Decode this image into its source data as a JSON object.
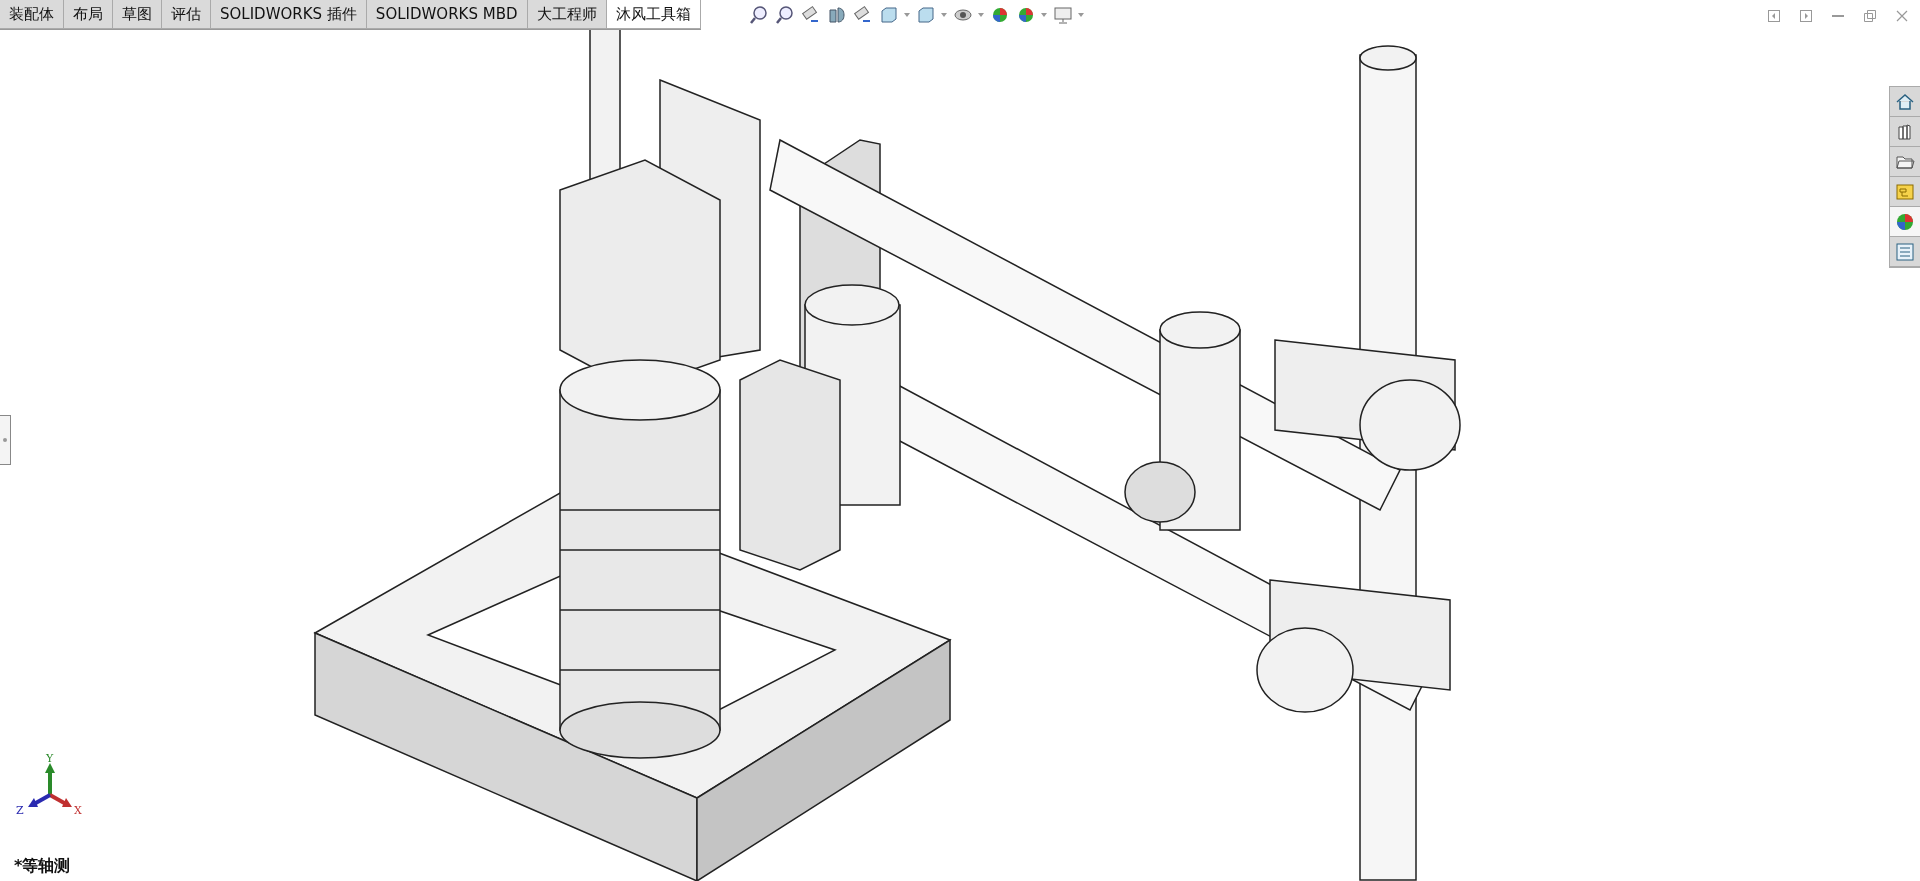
{
  "tabs": [
    {
      "label": "装配体",
      "selected": false
    },
    {
      "label": "布局",
      "selected": false
    },
    {
      "label": "草图",
      "selected": false
    },
    {
      "label": "评估",
      "selected": false
    },
    {
      "label": "SOLIDWORKS 插件",
      "selected": false
    },
    {
      "label": "SOLIDWORKS MBD",
      "selected": false
    },
    {
      "label": "大工程师",
      "selected": false
    },
    {
      "label": "沐风工具箱",
      "selected": true
    }
  ],
  "task_pane": [
    {
      "kind": "home",
      "selected": false
    },
    {
      "kind": "library",
      "selected": false
    },
    {
      "kind": "folder",
      "selected": false
    },
    {
      "kind": "palette",
      "selected": false
    },
    {
      "kind": "appearance",
      "selected": true
    },
    {
      "kind": "properties",
      "selected": false
    }
  ],
  "triad": {
    "x": "X",
    "y": "Y",
    "z": "Z"
  },
  "view_label": "*等轴测"
}
